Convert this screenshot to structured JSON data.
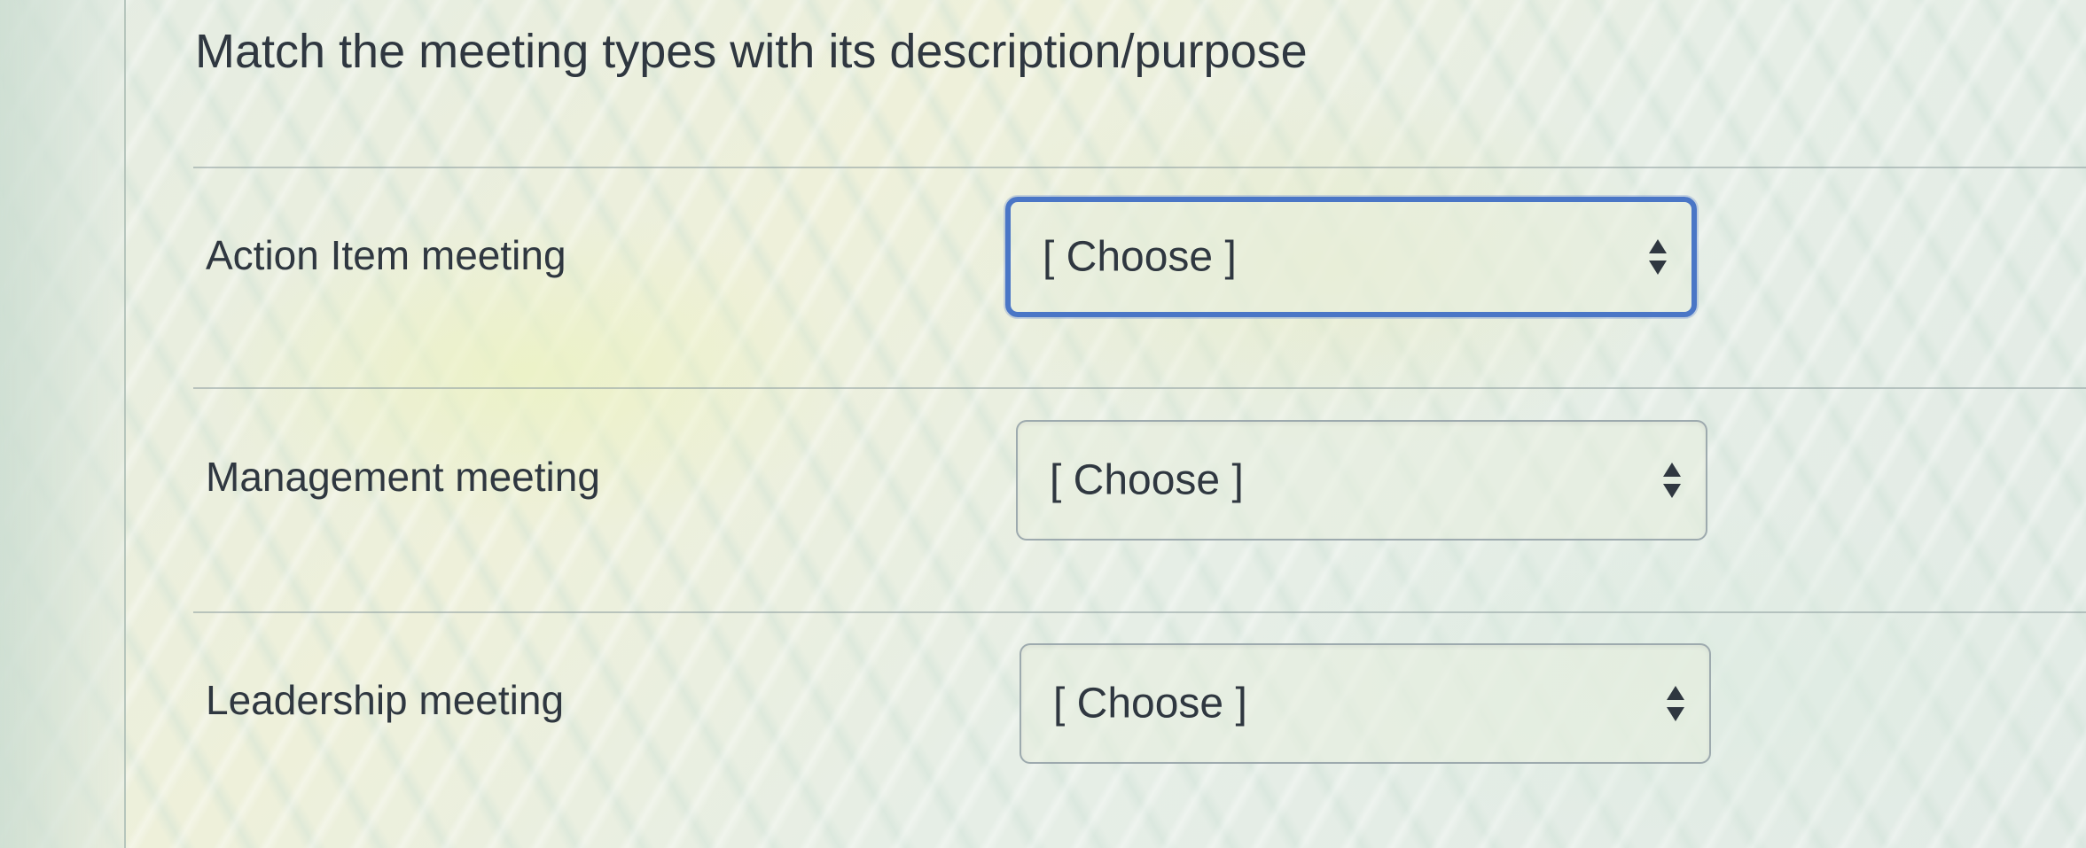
{
  "question": {
    "title": "Match the meeting types with its description/purpose"
  },
  "rows": [
    {
      "label": "Action Item meeting",
      "select_value": "[ Choose ]",
      "focused": true
    },
    {
      "label": "Management meeting",
      "select_value": "[ Choose ]",
      "focused": false
    },
    {
      "label": "Leadership meeting",
      "select_value": "[ Choose ]",
      "focused": false
    }
  ],
  "icons": {
    "select_arrow": "up-down-chevron-icon"
  },
  "colors": {
    "focus_border": "#4a76c6",
    "text": "#2f3740"
  }
}
